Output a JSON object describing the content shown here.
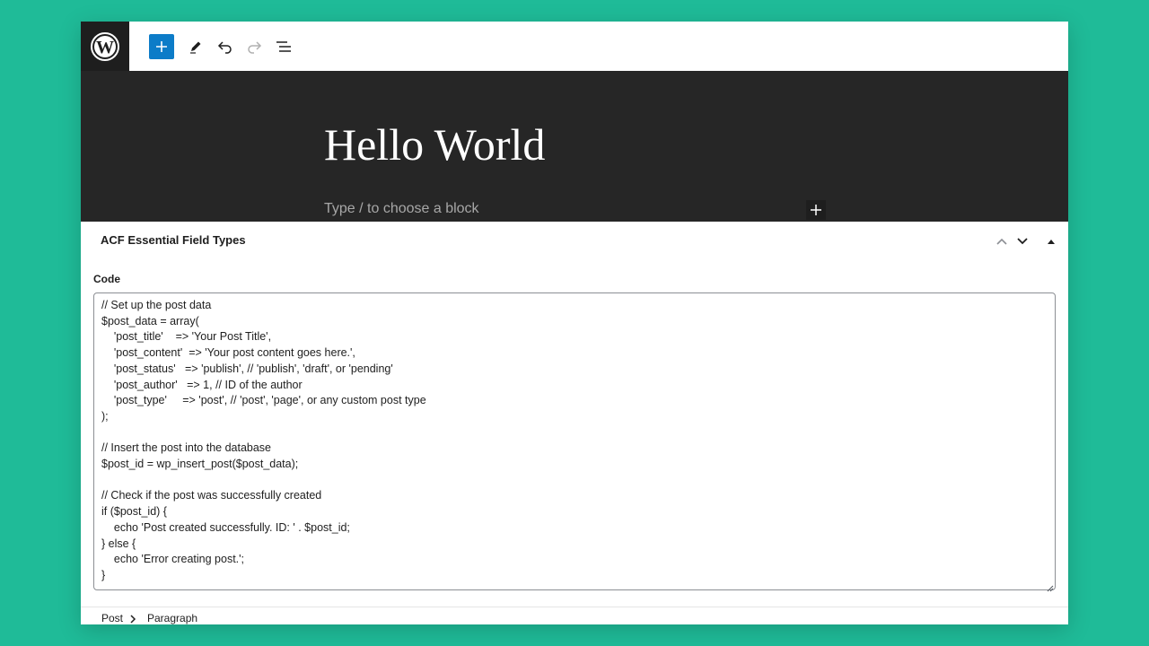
{
  "toolbar": {
    "logo_icon": "wordpress-logo-icon",
    "add_icon": "plus-icon",
    "edit_icon": "pencil-icon",
    "undo_icon": "undo-icon",
    "redo_icon": "redo-icon",
    "outline_icon": "list-view-icon",
    "accent_color": "#0c7cc8"
  },
  "editor": {
    "title": "Hello World",
    "block_placeholder": "Type / to choose a block"
  },
  "metabox": {
    "title": "ACF Essential Field Types",
    "field_label": "Code",
    "code_value": "// Set up the post data\n$post_data = array(\n    'post_title'    => 'Your Post Title',\n    'post_content'  => 'Your post content goes here.',\n    'post_status'   => 'publish', // 'publish', 'draft', or 'pending'\n    'post_author'   => 1, // ID of the author\n    'post_type'     => 'post', // 'post', 'page', or any custom post type\n);\n\n// Insert the post into the database\n$post_id = wp_insert_post($post_data);\n\n// Check if the post was successfully created\nif ($post_id) {\n    echo 'Post created successfully. ID: ' . $post_id;\n} else {\n    echo 'Error creating post.';\n}"
  },
  "breadcrumb": {
    "items": [
      "Post",
      "Paragraph"
    ]
  }
}
